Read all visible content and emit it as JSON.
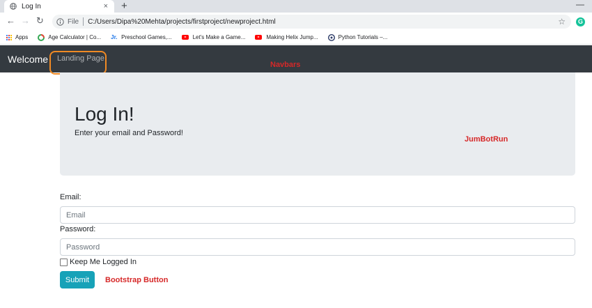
{
  "browser": {
    "tab_title": "Log In",
    "tab_close": "×",
    "new_tab": "+",
    "window_minimize": "—",
    "address": {
      "file_label": "File",
      "url": "C:/Users/Dipa%20Mehta/projects/firstproject/newproject.html"
    },
    "extension_letter": "G",
    "bookmarks": [
      {
        "label": "Apps",
        "icon": "apps-grid-icon"
      },
      {
        "label": "Age Calculator | Co...",
        "icon": "age-calculator-icon"
      },
      {
        "label": "Preschool Games,...",
        "icon": "preschool-icon"
      },
      {
        "label": "Let's Make a Game...",
        "icon": "youtube-icon"
      },
      {
        "label": "Making Helix Jump...",
        "icon": "youtube-icon"
      },
      {
        "label": "Python Tutorials –...",
        "icon": "python-icon"
      }
    ]
  },
  "navbar": {
    "brand": "Welcome",
    "link": "Landing Page"
  },
  "annotations": {
    "navbars": "Navbars",
    "jumbotron": "JumBotRun",
    "button": "Bootstrap Button"
  },
  "jumbotron": {
    "title": "Log In!",
    "lead": "Enter your email and Password!"
  },
  "form": {
    "email_label": "Email:",
    "email_placeholder": "Email",
    "password_label": "Password:",
    "password_placeholder": "Password",
    "remember_label": "Keep Me Logged In",
    "submit_label": "Submit"
  },
  "colors": {
    "navbar_bg": "#343a40",
    "jumbotron_bg": "#e9ecef",
    "button_bg": "#17a2b8",
    "annotation": "#d62828",
    "highlight": "#f08a24"
  }
}
